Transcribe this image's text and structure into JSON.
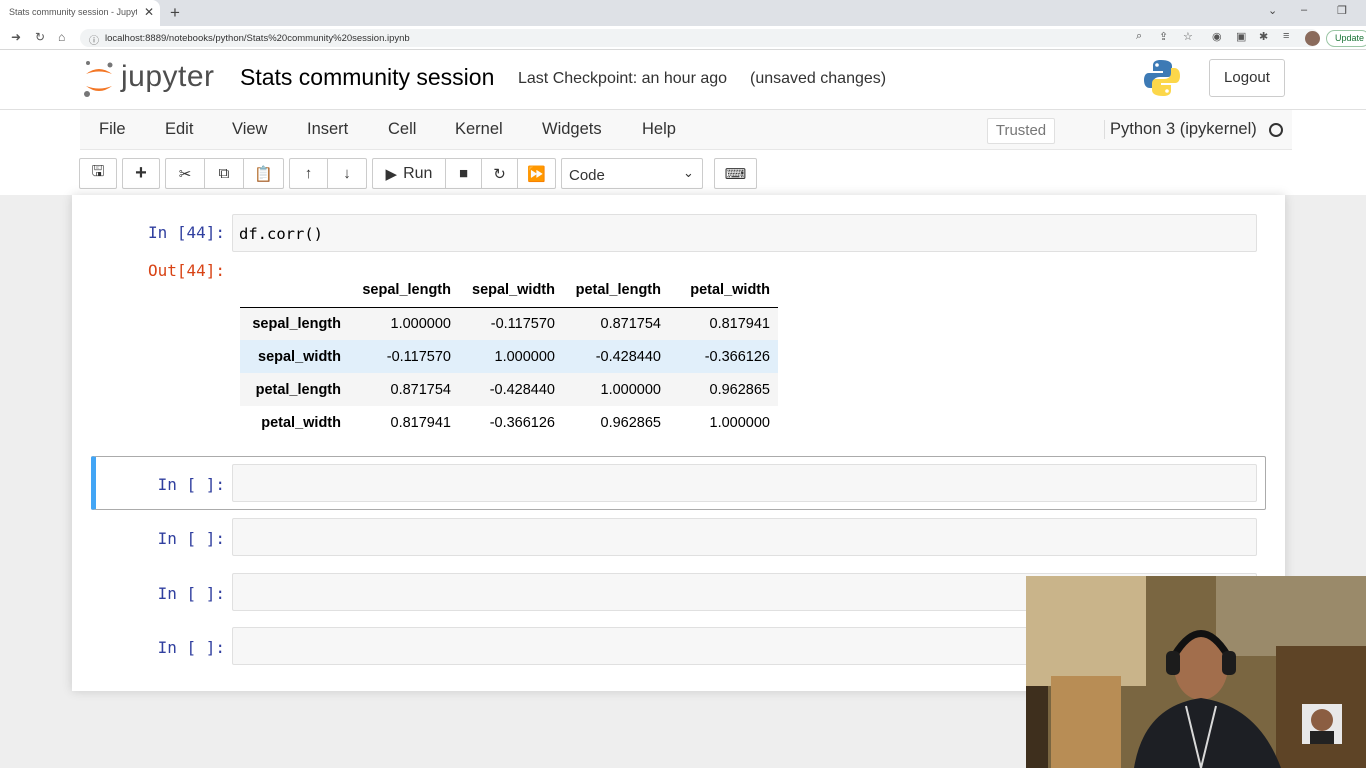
{
  "browser": {
    "tab_title": "Stats community session - Jupyter",
    "tab_close": "✕",
    "new_tab": "+",
    "url": "localhost:8889/notebooks/python/Stats%20community%20session.ipynb",
    "update_label": "Update"
  },
  "header": {
    "logo_text": "jupyter",
    "notebook_title": "Stats community session",
    "checkpoint": "Last Checkpoint: an hour ago",
    "unsaved": "(unsaved changes)",
    "logout_label": "Logout"
  },
  "menu": {
    "items": [
      "File",
      "Edit",
      "View",
      "Insert",
      "Cell",
      "Kernel",
      "Widgets",
      "Help"
    ],
    "trusted": "Trusted",
    "kernel": "Python 3 (ipykernel)"
  },
  "toolbar": {
    "run_label": "Run",
    "cell_type": "Code"
  },
  "cells": [
    {
      "prompt": "In [44]:",
      "code": "df.corr()",
      "output_prompt": "Out[44]:"
    },
    {
      "prompt": "In [ ]:",
      "code": ""
    },
    {
      "prompt": "In [ ]:",
      "code": ""
    },
    {
      "prompt": "In [ ]:",
      "code": ""
    },
    {
      "prompt": "In [ ]:",
      "code": ""
    }
  ],
  "output_table": {
    "columns": [
      "sepal_length",
      "sepal_width",
      "petal_length",
      "petal_width"
    ],
    "rows": [
      {
        "index": "sepal_length",
        "values": [
          "1.000000",
          "-0.117570",
          "0.871754",
          "0.817941"
        ]
      },
      {
        "index": "sepal_width",
        "values": [
          "-0.117570",
          "1.000000",
          "-0.428440",
          "-0.366126"
        ]
      },
      {
        "index": "petal_length",
        "values": [
          "0.871754",
          "-0.428440",
          "1.000000",
          "0.962865"
        ]
      },
      {
        "index": "petal_width",
        "values": [
          "0.817941",
          "-0.366126",
          "0.962865",
          "1.000000"
        ]
      }
    ]
  },
  "colors": {
    "selected_cell_accent": "#42a5f5",
    "in_prompt": "#303f9f",
    "out_prompt": "#d84315",
    "jupyter_orange": "#f37726"
  }
}
